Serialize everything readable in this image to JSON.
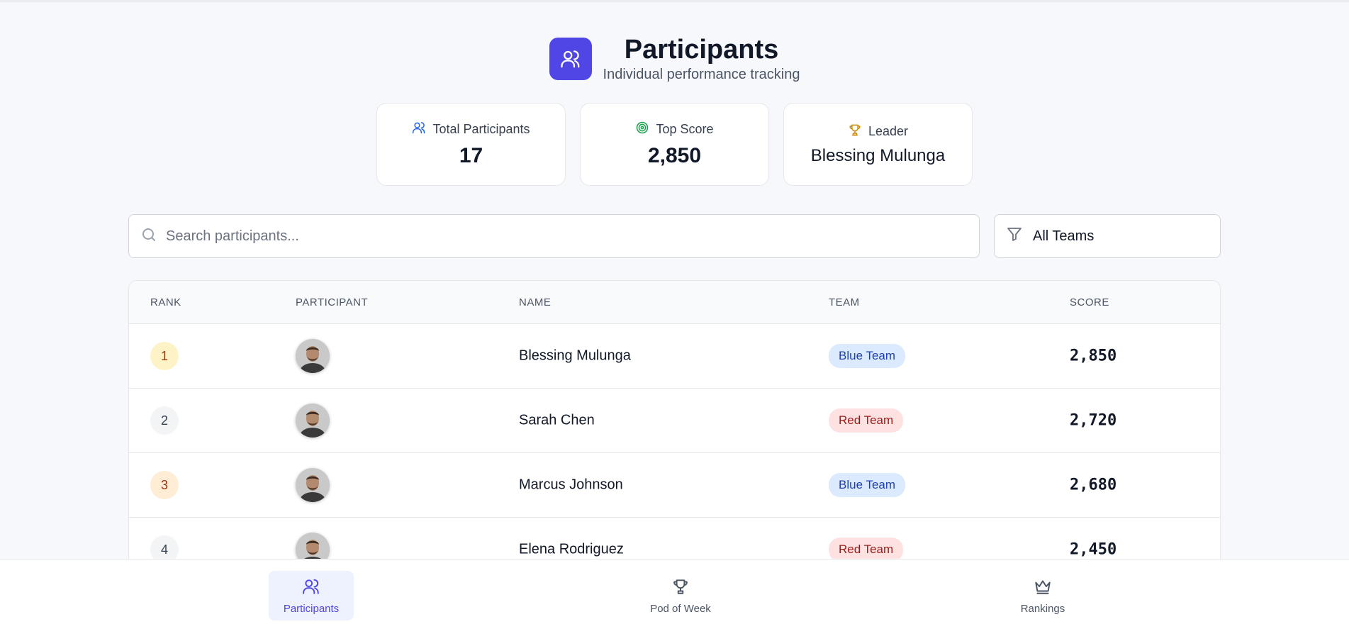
{
  "header": {
    "title": "Participants",
    "subtitle": "Individual performance tracking",
    "icon": "users-icon"
  },
  "stats": [
    {
      "label": "Total Participants",
      "value": "17",
      "icon": "users-icon",
      "color": "#2563eb"
    },
    {
      "label": "Top Score",
      "value": "2,850",
      "icon": "target-icon",
      "color": "#16a34a"
    },
    {
      "label": "Leader",
      "value": "Blessing Mulunga",
      "icon": "trophy-icon",
      "color": "#ca8a04"
    }
  ],
  "search": {
    "placeholder": "Search participants..."
  },
  "filter": {
    "selected": "All Teams"
  },
  "table": {
    "headers": [
      "RANK",
      "PARTICIPANT",
      "NAME",
      "TEAM",
      "SCORE"
    ],
    "rows": [
      {
        "rank": "1",
        "name": "Blessing Mulunga",
        "team": "Blue Team",
        "score": "2,850"
      },
      {
        "rank": "2",
        "name": "Sarah Chen",
        "team": "Red Team",
        "score": "2,720"
      },
      {
        "rank": "3",
        "name": "Marcus Johnson",
        "team": "Blue Team",
        "score": "2,680"
      },
      {
        "rank": "4",
        "name": "Elena Rodriguez",
        "team": "Red Team",
        "score": "2,450"
      }
    ]
  },
  "nav": {
    "items": [
      {
        "label": "Participants",
        "icon": "users-icon",
        "active": true
      },
      {
        "label": "Pod of Week",
        "icon": "trophy-icon",
        "active": false
      },
      {
        "label": "Rankings",
        "icon": "crown-icon",
        "active": false
      }
    ]
  },
  "colors": {
    "accent": "#4f46e5",
    "blue_team": "#1e40af",
    "red_team": "#991b1b"
  }
}
